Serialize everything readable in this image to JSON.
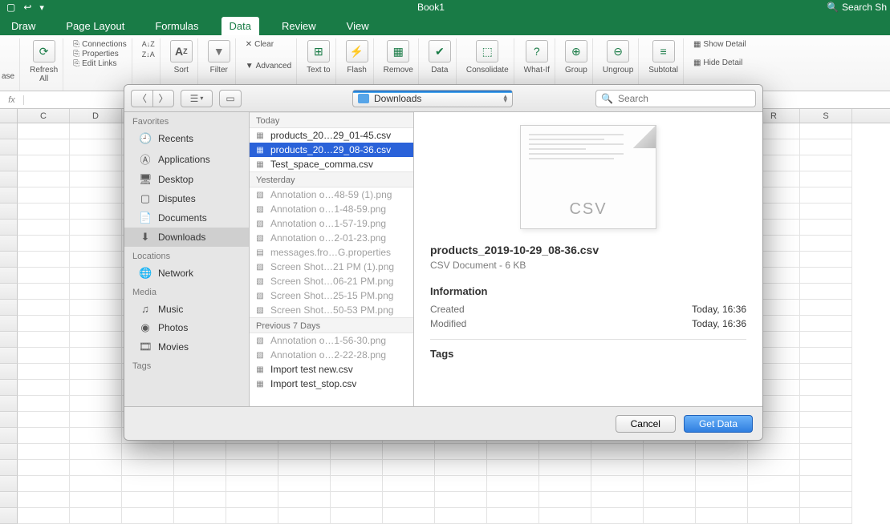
{
  "window": {
    "title": "Book1",
    "search_placeholder": "Search Sh"
  },
  "tabs": {
    "items": [
      "Draw",
      "Page Layout",
      "Formulas",
      "Data",
      "Review",
      "View"
    ],
    "active_index": 3
  },
  "ribbon": {
    "phase_label": "ase",
    "refresh": "Refresh\nAll",
    "connections_items": [
      "Connections",
      "Properties",
      "Edit Links"
    ],
    "sort": "Sort",
    "filter": "Filter",
    "clear": "Clear",
    "advanced": "Advanced",
    "text_to": "Text to",
    "flash": "Flash",
    "remove": "Remove",
    "data_tools": "Data",
    "consolidate": "Consolidate",
    "whatif": "What-If",
    "group": "Group",
    "ungroup": "Ungroup",
    "subtotal": "Subtotal",
    "show_detail": "Show Detail",
    "hide_detail": "Hide Detail"
  },
  "formula_bar": {
    "fx": "fx"
  },
  "columns": [
    "C",
    "D",
    "",
    "",
    "",
    "",
    "",
    "",
    "",
    "",
    "",
    "",
    "",
    "",
    "R",
    "S"
  ],
  "dialog": {
    "location": "Downloads",
    "search_placeholder": "Search",
    "sidebar": {
      "favorites_label": "Favorites",
      "favorites": [
        "Recents",
        "Applications",
        "Desktop",
        "Disputes",
        "Documents",
        "Downloads"
      ],
      "favorites_selected": 5,
      "locations_label": "Locations",
      "locations": [
        "Network"
      ],
      "media_label": "Media",
      "media": [
        "Music",
        "Photos",
        "Movies"
      ],
      "tags_label": "Tags"
    },
    "files": {
      "sections": [
        {
          "label": "Today",
          "items": [
            {
              "name": "products_20…29_01-45.csv",
              "dim": false,
              "icon": "csv"
            },
            {
              "name": "products_20…29_08-36.csv",
              "dim": false,
              "icon": "csv",
              "selected": true
            },
            {
              "name": "Test_space_comma.csv",
              "dim": false,
              "icon": "csv"
            }
          ]
        },
        {
          "label": "Yesterday",
          "items": [
            {
              "name": "Annotation o…48-59 (1).png",
              "dim": true,
              "icon": "img"
            },
            {
              "name": "Annotation o…1-48-59.png",
              "dim": true,
              "icon": "img"
            },
            {
              "name": "Annotation o…1-57-19.png",
              "dim": true,
              "icon": "img"
            },
            {
              "name": "Annotation o…2-01-23.png",
              "dim": true,
              "icon": "img"
            },
            {
              "name": "messages.fro…G.properties",
              "dim": true,
              "icon": "txt"
            },
            {
              "name": "Screen Shot…21 PM (1).png",
              "dim": true,
              "icon": "img"
            },
            {
              "name": "Screen Shot…06-21 PM.png",
              "dim": true,
              "icon": "img"
            },
            {
              "name": "Screen Shot…25-15 PM.png",
              "dim": true,
              "icon": "img"
            },
            {
              "name": "Screen Shot…50-53 PM.png",
              "dim": true,
              "icon": "img"
            }
          ]
        },
        {
          "label": "Previous 7 Days",
          "items": [
            {
              "name": "Annotation o…1-56-30.png",
              "dim": true,
              "icon": "img"
            },
            {
              "name": "Annotation o…2-22-28.png",
              "dim": true,
              "icon": "img"
            },
            {
              "name": "Import test new.csv",
              "dim": false,
              "icon": "csv"
            },
            {
              "name": "Import test_stop.csv",
              "dim": false,
              "icon": "csv"
            }
          ]
        }
      ]
    },
    "preview": {
      "thumb_type": "CSV",
      "filename": "products_2019-10-29_08-36.csv",
      "subtitle": "CSV Document - 6 KB",
      "info_label": "Information",
      "created_label": "Created",
      "created_value": "Today, 16:36",
      "modified_label": "Modified",
      "modified_value": "Today, 16:36",
      "tags_label": "Tags"
    },
    "footer": {
      "cancel": "Cancel",
      "confirm": "Get Data"
    }
  }
}
